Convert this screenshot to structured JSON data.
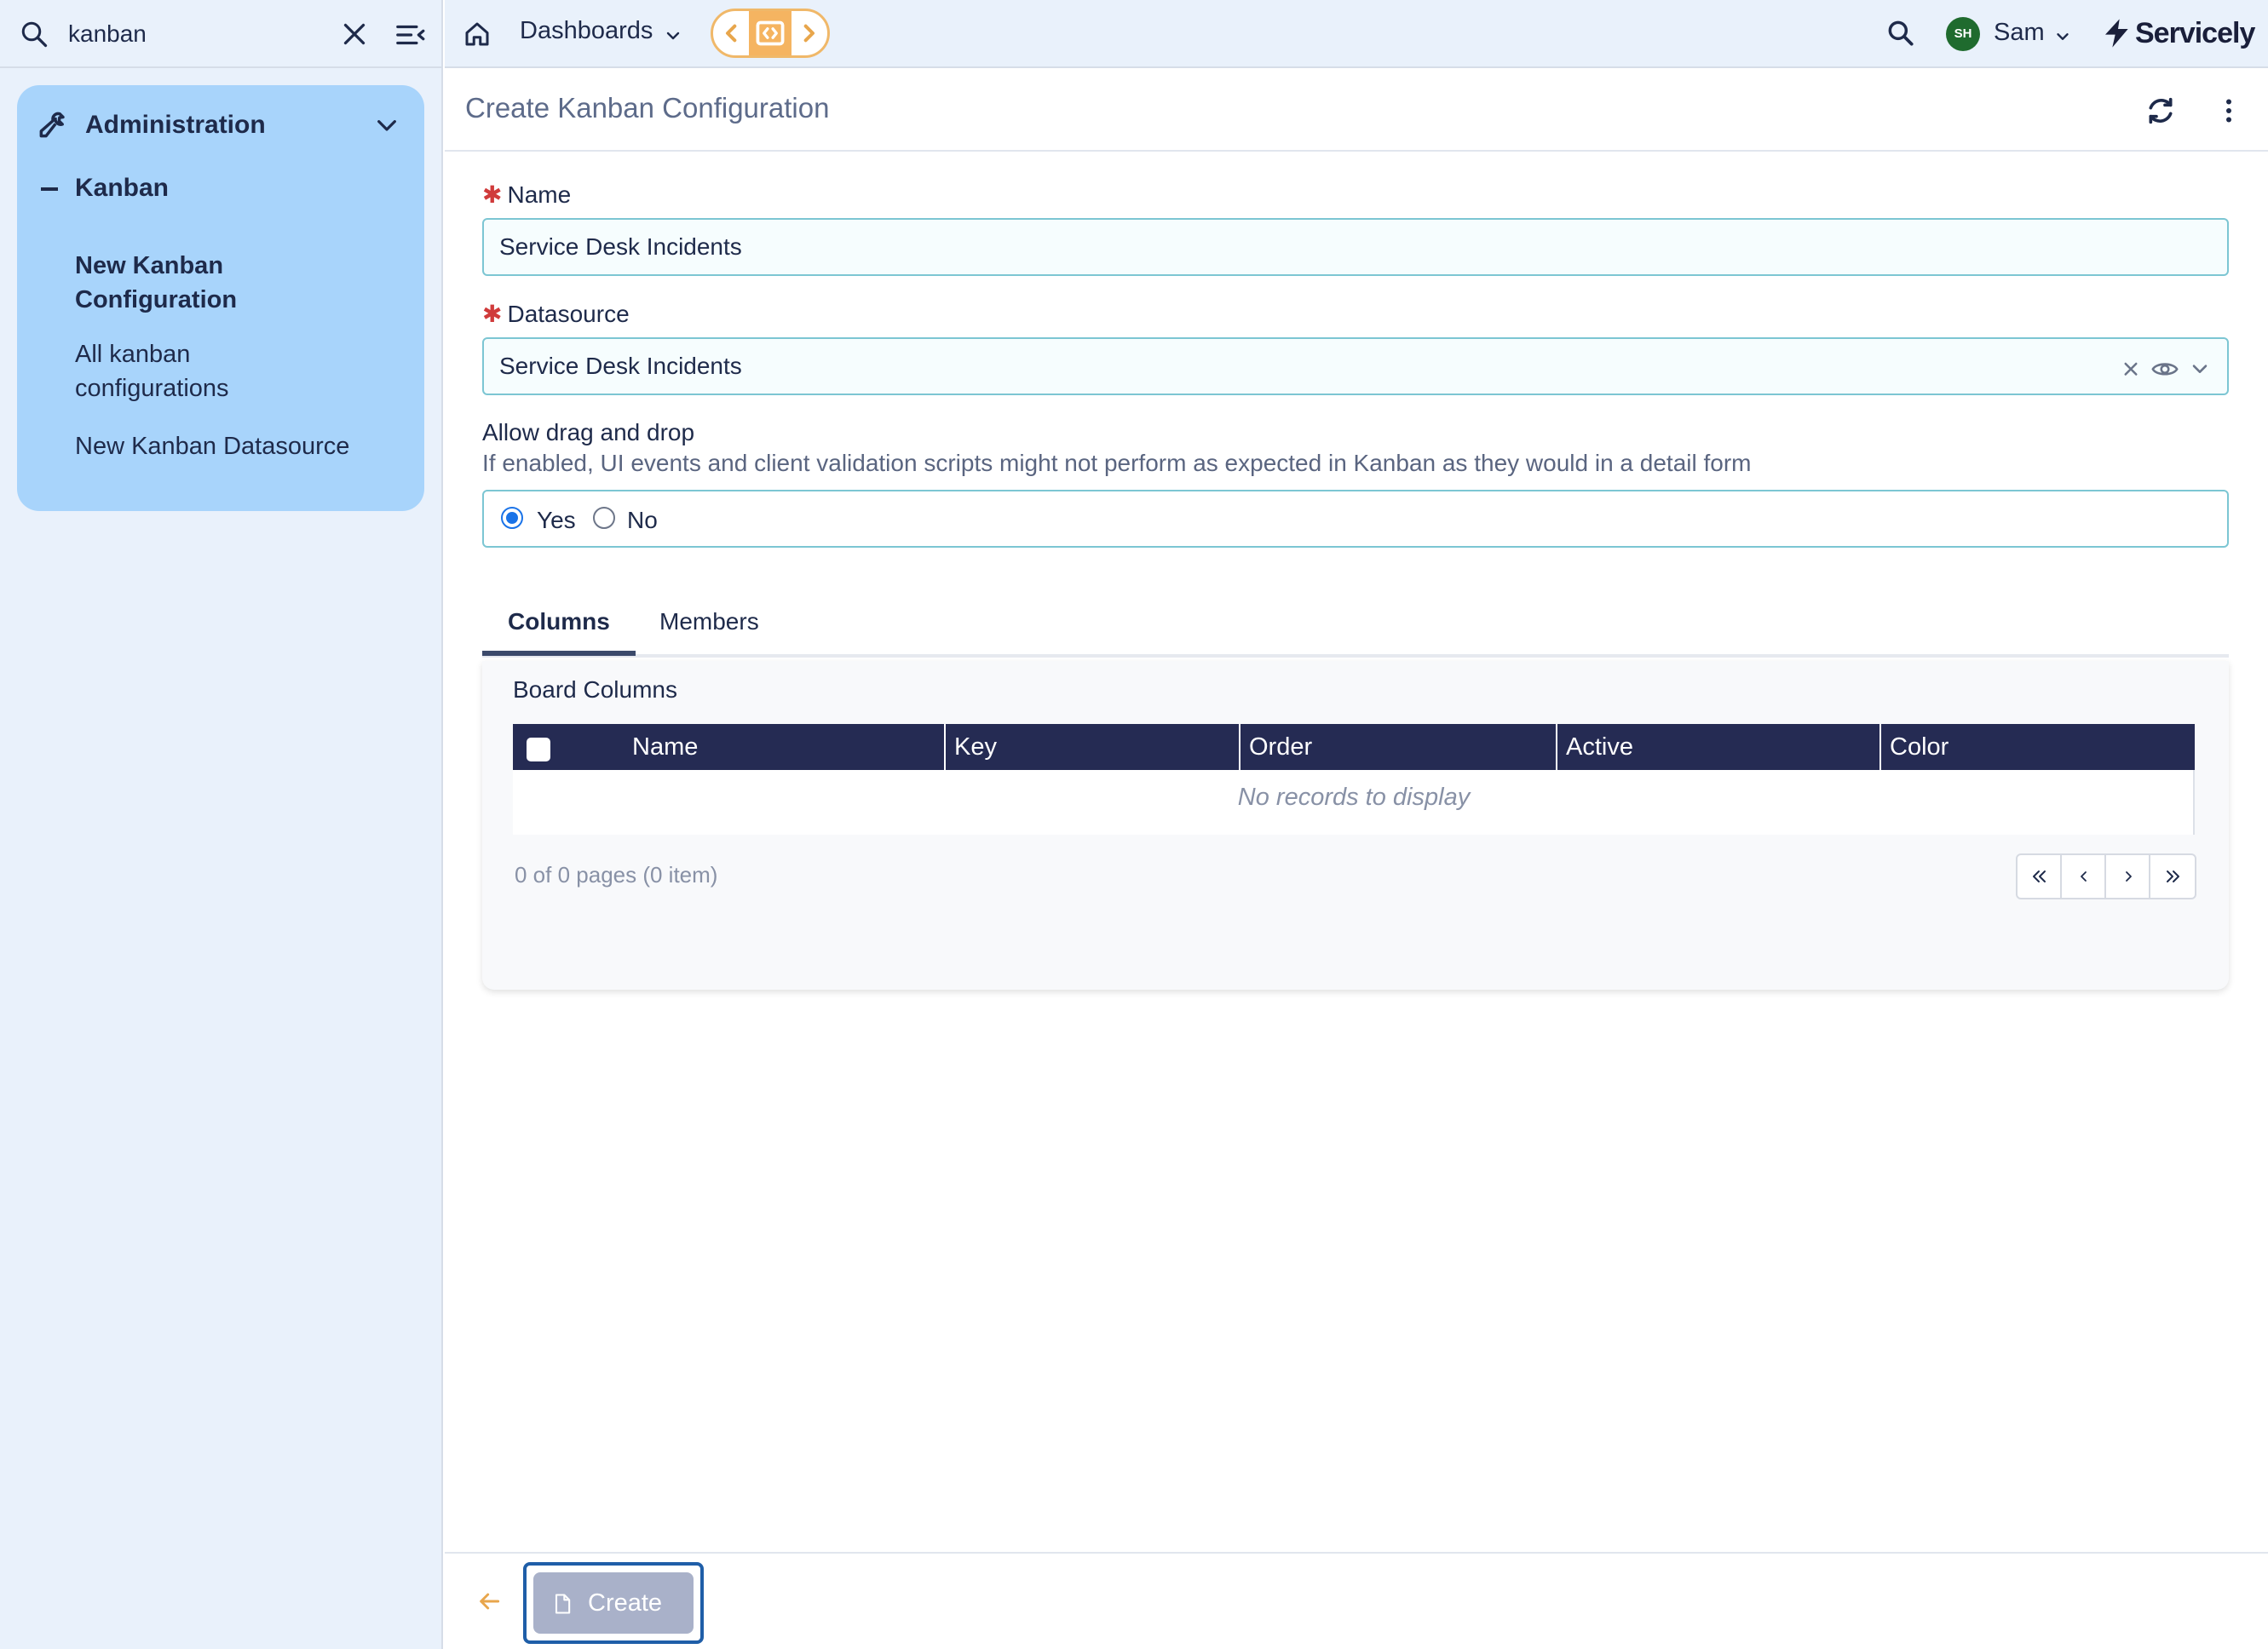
{
  "sidebar": {
    "search_value": "kanban",
    "section_title": "Administration",
    "group_label": "Kanban",
    "items": [
      {
        "label_line1": "New Kanban",
        "label_line2": "Configuration"
      },
      {
        "label_line1": "All kanban",
        "label_line2": "configurations"
      },
      {
        "label_line1": "New Kanban Datasource",
        "label_line2": ""
      }
    ]
  },
  "topbar": {
    "dashboards_label": "Dashboards",
    "user_initials": "SH",
    "user_name": "Sam",
    "brand": "Servicely"
  },
  "page": {
    "title": "Create Kanban Configuration"
  },
  "form": {
    "name_label": "Name",
    "name_value": "Service Desk Incidents",
    "datasource_label": "Datasource",
    "datasource_value": "Service Desk Incidents",
    "drag_label": "Allow drag and drop",
    "drag_help": "If enabled, UI events and client validation scripts might not perform as expected in Kanban as they would in a detail form",
    "yes_label": "Yes",
    "no_label": "No",
    "selected": "Yes"
  },
  "tabs": [
    {
      "label": "Columns"
    },
    {
      "label": "Members"
    }
  ],
  "board_columns": {
    "title": "Board Columns",
    "headers": [
      "Name",
      "Key",
      "Order",
      "Active",
      "Color"
    ],
    "empty_message": "No records to display",
    "pager_info": "0 of 0 pages (0 item)"
  },
  "footer": {
    "create_label": "Create"
  },
  "colors": {
    "nav_card": "#a8d4fb",
    "grid_header": "#252b53",
    "accent_orange": "#f5b461",
    "focus_border": "#1f5ea8"
  }
}
